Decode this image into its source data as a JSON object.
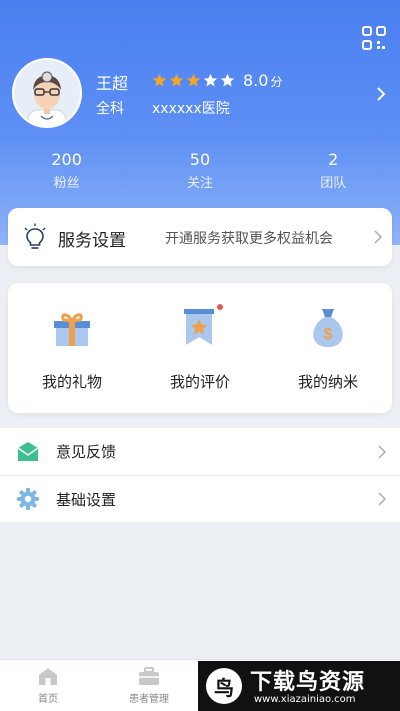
{
  "profile": {
    "name": "王超",
    "rating": 3,
    "rating_max": 5,
    "score": "8.0",
    "score_unit": "分",
    "department": "全科",
    "hospital": "xxxxxx医院"
  },
  "stats": [
    {
      "value": "200",
      "label": "粉丝"
    },
    {
      "value": "50",
      "label": "关注"
    },
    {
      "value": "2",
      "label": "团队"
    }
  ],
  "service": {
    "title": "服务设置",
    "description": "开通服务获取更多权益机会"
  },
  "features": [
    {
      "label": "我的礼物",
      "icon": "gift-icon"
    },
    {
      "label": "我的评价",
      "icon": "review-ribbon-icon"
    },
    {
      "label": "我的纳米",
      "icon": "money-bag-icon"
    }
  ],
  "menu": [
    {
      "label": "意见反馈",
      "icon": "feedback-envelope-icon"
    },
    {
      "label": "基础设置",
      "icon": "gear-icon"
    }
  ],
  "tabbar": [
    {
      "label": "首页",
      "icon": "home-icon"
    },
    {
      "label": "患者管理",
      "icon": "briefcase-icon"
    }
  ],
  "watermark": {
    "logo_char": "鸟",
    "title": "下载鸟资源",
    "url": "www.xiazainiao.com"
  },
  "colors": {
    "header_blue": "#4a7ff0",
    "star_filled": "#f5a623",
    "star_empty": "#ffffff",
    "feedback_green": "#3dbf8f",
    "gear_blue": "#7fb6e8"
  }
}
